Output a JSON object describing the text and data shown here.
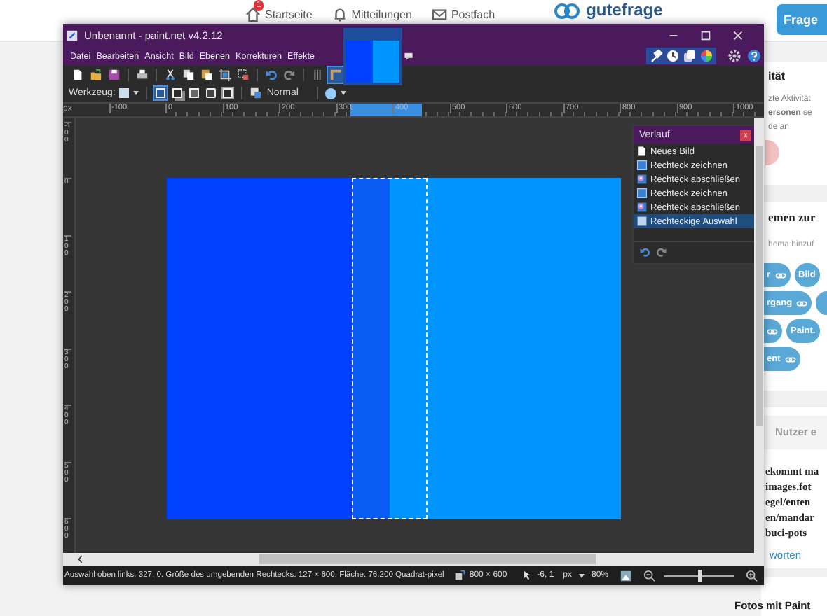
{
  "website": {
    "nav": [
      {
        "label": "Startseite",
        "badge": "1",
        "kind": "home"
      },
      {
        "label": "Mitteilungen",
        "kind": "bell"
      },
      {
        "label": "Postfach",
        "kind": "mail"
      }
    ],
    "logo": "gutefrage",
    "ask_button": "Frage",
    "sidebar": {
      "activity_title": "ität",
      "activity_text": "zte Aktivität",
      "activity_note": "**ersonen** se",
      "activity_note_2": "de an",
      "topics_title": "emen zur",
      "topics_hint": "hema hinzuf",
      "tags": [
        {
          "label": "r",
          "link": true
        },
        {
          "label": "Bild",
          "link": false
        },
        {
          "label": "rgang",
          "link": true
        },
        {
          "link": false
        },
        {
          "link": true
        },
        {
          "label": "Paint.",
          "link": false
        },
        {
          "label": "ent",
          "link": true
        }
      ],
      "users_title": "Nutzer e",
      "answer_lines": [
        "ekommt ma",
        "images.fot",
        "egel/enten",
        "en/mandar",
        "buci-pots"
      ],
      "answers_link": "worten",
      "next_title": "Fotos mit Paint"
    }
  },
  "window": {
    "title": "Unbenannt - paint.net v4.2.12",
    "menu": [
      "Datei",
      "Bearbeiten",
      "Ansicht",
      "Bild",
      "Ebenen",
      "Korrekturen",
      "Effekte"
    ],
    "panel_toggles": [
      {
        "kind": "tools",
        "on": true
      },
      {
        "kind": "history",
        "on": true
      },
      {
        "kind": "layers",
        "on": true
      },
      {
        "kind": "colors",
        "on": true
      }
    ],
    "toolbar": [
      {
        "kind": "new"
      },
      {
        "kind": "open"
      },
      {
        "kind": "save"
      },
      {
        "kind": "sep"
      },
      {
        "kind": "print"
      },
      {
        "kind": "sep"
      },
      {
        "kind": "cut"
      },
      {
        "kind": "copy"
      },
      {
        "kind": "paste"
      },
      {
        "kind": "crop"
      },
      {
        "kind": "deselect"
      },
      {
        "kind": "sep"
      },
      {
        "kind": "undo"
      },
      {
        "kind": "redo"
      },
      {
        "kind": "sep"
      },
      {
        "kind": "grid",
        "on": false
      },
      {
        "kind": "ruler",
        "on": true
      }
    ],
    "tool_label": "Werkzeug:",
    "selection_modes": [
      {
        "selected": true
      },
      {
        "selected": false
      },
      {
        "selected": false
      },
      {
        "selected": false
      },
      {
        "selected": false
      }
    ],
    "blend_mode": "Normal",
    "ruler_unit": "px",
    "h_ruler": [
      "-100",
      "0",
      "100",
      "200",
      "300",
      "400",
      "500",
      "600",
      "700",
      "800",
      "900",
      "1000"
    ],
    "v_ruler": [
      "-100",
      "0",
      "100",
      "200",
      "300",
      "400",
      "500",
      "600"
    ],
    "history": {
      "title": "Verlauf",
      "close": "x",
      "items": [
        {
          "label": "Neues Bild",
          "kind": "new",
          "selected": false
        },
        {
          "label": "Rechteck zeichnen",
          "kind": "rect",
          "selected": false
        },
        {
          "label": "Rechteck abschließen",
          "kind": "finish",
          "selected": false
        },
        {
          "label": "Rechteck zeichnen",
          "kind": "rect",
          "selected": false
        },
        {
          "label": "Rechteck abschließen",
          "kind": "finish",
          "selected": false
        },
        {
          "label": "Rechteckige Auswahl",
          "kind": "select",
          "selected": true
        }
      ]
    },
    "status": {
      "text": "Auswahl oben links: 327, 0. Größe des umgebenden Rechtecks: 127 × 600. Fläche: 76.200 Quadrat-pixel",
      "image_size": "800 × 600",
      "cursor": "-6, 1",
      "unit": "px",
      "zoom": "80%",
      "zoom_slider": {
        "level": 0.5
      }
    }
  }
}
